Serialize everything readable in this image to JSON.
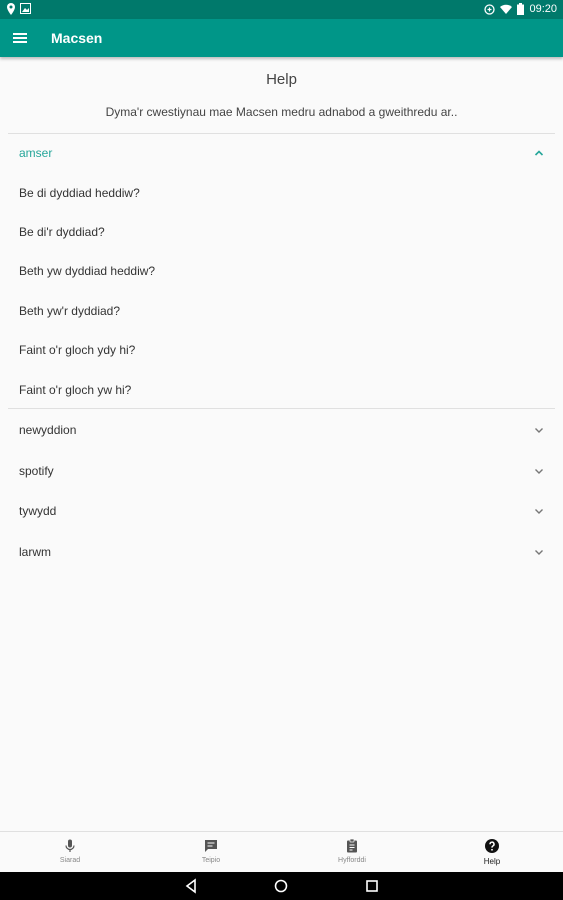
{
  "status_bar": {
    "time": "09:20"
  },
  "app_bar": {
    "title": "Macsen",
    "menu_icon": "menu-icon"
  },
  "help": {
    "title": "Help",
    "subtitle": "Dyma'r cwestiynau mae Macsen medru adnabod a gweithredu ar.."
  },
  "sections": [
    {
      "label": "amser",
      "expanded": true,
      "questions": [
        "Be di dyddiad heddiw?",
        "Be di'r dyddiad?",
        "Beth yw dyddiad heddiw?",
        "Beth yw'r dyddiad?",
        "Faint o'r gloch ydy hi?",
        "Faint o'r gloch yw hi?"
      ]
    },
    {
      "label": "newyddion",
      "expanded": false
    },
    {
      "label": "spotify",
      "expanded": false
    },
    {
      "label": "tywydd",
      "expanded": false
    },
    {
      "label": "larwm",
      "expanded": false
    }
  ],
  "bottom_nav": [
    {
      "label": "Siarad",
      "icon": "microphone-icon"
    },
    {
      "label": "Teipio",
      "icon": "chat-icon"
    },
    {
      "label": "Hyfforddi",
      "icon": "clipboard-icon"
    },
    {
      "label": "Help",
      "icon": "help-icon",
      "active": true
    }
  ],
  "colors": {
    "primary": "#009688",
    "primary_dark": "#00796b",
    "accent": "#26a69a"
  }
}
